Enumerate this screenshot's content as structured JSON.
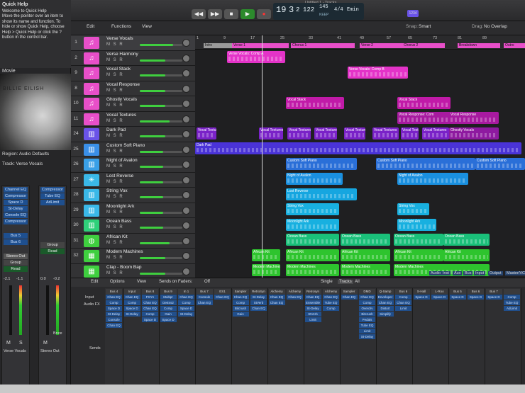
{
  "window": {
    "title": "Untitled 1 - Tracks",
    "lcd": {
      "bar": "19",
      "beat": "3",
      "div": "2",
      "tick": "122",
      "tempo": "145",
      "tempo_label": "KEEP",
      "sig": "4/4",
      "key": "Emin"
    },
    "badge": "1234"
  },
  "quick_help": {
    "title": "Quick Help",
    "lines": [
      "Welcome to Quick Help",
      "Move the pointer over an item to",
      "show its name and function. To",
      "hide or show Quick Help, choose",
      "Help > Quick Help or click the ?",
      "button in the control bar."
    ]
  },
  "inspector": {
    "movie_label": "Movie",
    "image_text_top": "BILLIE EILISH",
    "region_label": "Region: Audio Defaults",
    "track_label": "Track: Verse Vocals",
    "strip_left": {
      "plugins": [
        "Channel EQ",
        "Compressor",
        "Space D",
        "St-Delay",
        "Console EQ",
        "Compressor"
      ],
      "sends": [
        "Bus 5",
        "Bus 6"
      ],
      "output": "Stereo Out",
      "group": "Group",
      "automation": "Read",
      "vals": [
        "-2.1",
        "-1.1"
      ],
      "name": "Verse Vocals"
    },
    "strip_right": {
      "plugins": [
        "Compressor",
        "Tube EQ",
        "AdLimit"
      ],
      "output": "Stereo Out",
      "group": "Group",
      "automation": "Read",
      "vals": [
        "0.0",
        "-0.2"
      ],
      "bounce": "Bnce",
      "name": "Stereo Out"
    }
  },
  "toolbar": {
    "edit": "Edit",
    "functions": "Functions",
    "view": "View",
    "snap_label": "Snap:",
    "snap": "Smart",
    "drag_label": "Drag:",
    "drag": "No Overlap"
  },
  "tracks": [
    {
      "num": "1",
      "name": "Verse Vocals",
      "color": "#e84fc9",
      "icon": "mic-icon",
      "glyph": "♫",
      "vol": 0.78
    },
    {
      "num": "2",
      "name": "Verse Harmony",
      "color": "#e84fc9",
      "icon": "mic-icon",
      "glyph": "♫",
      "vol": 0.6
    },
    {
      "num": "9",
      "name": "Vocal Stack",
      "color": "#e84fc9",
      "icon": "mic-icon",
      "glyph": "♫",
      "vol": 0.6
    },
    {
      "num": "8",
      "name": "Vocal Response",
      "color": "#e84fc9",
      "icon": "mic-icon",
      "glyph": "♫",
      "vol": 0.6
    },
    {
      "num": "10",
      "name": "Ghostly Vocals",
      "color": "#e84fc9",
      "icon": "mic-icon",
      "glyph": "♫",
      "vol": 0.6
    },
    {
      "num": "11",
      "name": "Vocal Textures",
      "color": "#e84fc9",
      "icon": "mic-icon",
      "glyph": "♫",
      "vol": 0.7
    },
    {
      "num": "24",
      "name": "Dark Pad",
      "color": "#6a53e8",
      "icon": "keyboard-icon",
      "glyph": "▥",
      "vol": 0.6
    },
    {
      "num": "25",
      "name": "Custom Soft Piano",
      "color": "#3a8fe8",
      "icon": "piano-icon",
      "glyph": "▥",
      "vol": 0.55
    },
    {
      "num": "26",
      "name": "Night of Avalon",
      "color": "#3aa0e8",
      "icon": "synth-icon",
      "glyph": "▥",
      "vol": 0.55
    },
    {
      "num": "27",
      "name": "Lost Reverse",
      "color": "#3ab8e8",
      "icon": "synth-icon",
      "glyph": "✳",
      "vol": 0.55
    },
    {
      "num": "28",
      "name": "String Vox",
      "color": "#3ab8e8",
      "icon": "synth-icon",
      "glyph": "▥",
      "vol": 0.55
    },
    {
      "num": "29",
      "name": "Moonlight Ark",
      "color": "#3ab8e8",
      "icon": "synth-icon",
      "glyph": "▥",
      "vol": 0.55
    },
    {
      "num": "30",
      "name": "Ocean Bass",
      "color": "#2fd07a",
      "icon": "bass-icon",
      "glyph": "▥",
      "vol": 0.55
    },
    {
      "num": "31",
      "name": "African Kit",
      "color": "#3fcf3f",
      "icon": "drum-icon",
      "glyph": "◍",
      "vol": 0.7
    },
    {
      "num": "32",
      "name": "Modern Machines",
      "color": "#3fcf3f",
      "icon": "drum-machine-icon",
      "glyph": "▦",
      "vol": 0.6
    },
    {
      "num": "",
      "name": "Clap - Boom Bap",
      "color": "#3fcf3f",
      "icon": "drum-icon",
      "glyph": "▦",
      "vol": 0.6
    }
  ],
  "ruler": {
    "numbers": [
      "1",
      "9",
      "17",
      "25",
      "33",
      "41",
      "49",
      "57",
      "65",
      "73",
      "81",
      "89"
    ],
    "markers": [
      {
        "label": "Intro",
        "color": "#9a9a9a"
      },
      {
        "label": "Verse 1",
        "color": "#e84fc9"
      },
      {
        "label": "Chorus 1",
        "color": "#e84fc9"
      },
      {
        "label": "Verse 2",
        "color": "#e84fc9"
      },
      {
        "label": "Chorus 2",
        "color": "#e84fc9"
      },
      {
        "label": "Breakdown",
        "color": "#e84fc9"
      },
      {
        "label": "Outro",
        "color": "#e84fc9"
      }
    ]
  },
  "regions": [
    {
      "row": 0,
      "label": "Verse Vocals: Comp A",
      "color": "#e433c8"
    },
    {
      "row": 1,
      "label": "Verse Vocals: Comp B",
      "color": "#e433c8"
    },
    {
      "row": 3,
      "label": "Vocal Stack",
      "color": "#c11aa8"
    },
    {
      "row": 3,
      "label": "Vocal Stack",
      "color": "#c11aa8"
    },
    {
      "row": 4,
      "label": "Vocal Response: Com",
      "color": "#a81aa0"
    },
    {
      "row": 4,
      "label": "Vocal Response",
      "color": "#a81aa0"
    },
    {
      "row": 5,
      "label": "Ghostly Vocals",
      "color": "#8e1aa0"
    },
    {
      "row": 5,
      "label": "Vocal Textures",
      "color": "#7a22c8"
    },
    {
      "row": 5,
      "label": "Vocal Textures",
      "color": "#7a22c8"
    },
    {
      "row": 5,
      "label": "Vocal Textures",
      "color": "#7a22c8"
    },
    {
      "row": 5,
      "label": "Vocal Textures",
      "color": "#7a22c8"
    },
    {
      "row": 5,
      "label": "Vocal Textures",
      "color": "#7a22c8"
    },
    {
      "row": 5,
      "label": "Vocal Textures",
      "color": "#7a22c8"
    },
    {
      "row": 5,
      "label": "Vocal Textures",
      "color": "#7a22c8"
    },
    {
      "row": 5,
      "label": "Vocal Textures",
      "color": "#7a22c8"
    },
    {
      "row": 6,
      "label": "Dark Pad",
      "color": "#4a33d8"
    },
    {
      "row": 6,
      "label": "Dark Pad",
      "color": "#4a33d8"
    },
    {
      "row": 7,
      "label": "Custom Soft Piano",
      "color": "#2a6fd8"
    },
    {
      "row": 7,
      "label": "Custom Soft Piano",
      "color": "#2a6fd8"
    },
    {
      "row": 7,
      "label": "Custom Soft Piano",
      "color": "#2a6fd8"
    },
    {
      "row": 8,
      "label": "Night of Avalon",
      "color": "#1a90e0"
    },
    {
      "row": 8,
      "label": "Night of Avalon",
      "color": "#1a90e0"
    },
    {
      "row": 9,
      "label": "Lost Reverse",
      "color": "#16a6e0"
    },
    {
      "row": 10,
      "label": "String Vox",
      "color": "#18b0e0"
    },
    {
      "row": 10,
      "label": "String Vox",
      "color": "#18b0e0"
    },
    {
      "row": 11,
      "label": "Moonlight Ark",
      "color": "#18b0e0"
    },
    {
      "row": 11,
      "label": "Moonlight Ark",
      "color": "#18b0e0"
    },
    {
      "row": 12,
      "label": "Ocean Bass",
      "color": "#1ac07a"
    },
    {
      "row": 12,
      "label": "Ocean Bass",
      "color": "#1ac07a"
    },
    {
      "row": 12,
      "label": "Ocean Bass",
      "color": "#1ac07a"
    },
    {
      "row": 12,
      "label": "Ocean Bass",
      "color": "#1ac07a"
    },
    {
      "row": 13,
      "label": "African Kit",
      "color": "#2ec42e"
    },
    {
      "row": 13,
      "label": "African Kit",
      "color": "#2ec42e"
    },
    {
      "row": 13,
      "label": "African Kit",
      "color": "#2ec42e"
    },
    {
      "row": 13,
      "label": "African Kit",
      "color": "#2ec42e"
    },
    {
      "row": 13,
      "label": "African Kit",
      "color": "#2ec42e"
    },
    {
      "row": 14,
      "label": "Modern Machines",
      "color": "#2ec42e"
    },
    {
      "row": 14,
      "label": "Modern Machines",
      "color": "#2ec42e"
    },
    {
      "row": 14,
      "label": "Modern Machines",
      "color": "#2ec42e"
    },
    {
      "row": 14,
      "label": "Modern Machines",
      "color": "#2ec42e"
    },
    {
      "row": 15,
      "label": "Clap - Boom Bap",
      "color": "#2ec42e"
    },
    {
      "row": 15,
      "label": "Clap - Boom Bap",
      "color": "#2ec42e"
    }
  ],
  "mixer": {
    "edit": "Edit",
    "options": "Options",
    "view": "View",
    "sends_on_faders": "Sends on Faders:",
    "off": "Off",
    "tabs": [
      "Single",
      "Tracks",
      "All"
    ],
    "filters": [
      "Audio",
      "Inst",
      "Aux",
      "Bus",
      "Input",
      "Output",
      "Master/VCA"
    ],
    "row_labels": [
      "Input",
      "Audio FX",
      "Sends"
    ],
    "columns": [
      {
        "top": "Bus 4",
        "fx": [
          "Chan EQ",
          "Comp",
          "Space D",
          "St-Delay",
          "Console",
          "Chan EQ"
        ]
      },
      {
        "top": "Input",
        "fx": [
          "Chan EQ",
          "Comp",
          "Space D",
          "St-Delay"
        ]
      },
      {
        "top": "Bus 8",
        "fx": [
          "PSYn",
          "Chan EQ",
          "Chan EQ",
          "Comp",
          "Space D"
        ]
      },
      {
        "top": "Bus 9",
        "fx": [
          "Multipr",
          "DeEss2",
          "Comp",
          "Gain",
          "Space D"
        ]
      },
      {
        "top": "In 1",
        "fx": [
          "Chan EQ",
          "Comp",
          "Space D",
          "St-Delay"
        ]
      },
      {
        "top": "Bus 7",
        "fx": [
          "Console",
          "Chan EQ"
        ]
      },
      {
        "top": "ES1",
        "fx": [
          "Chan EQ"
        ]
      },
      {
        "top": "Sampler",
        "fx": [
          "Chan EQ",
          "Comp",
          "Bitcrush",
          "Gain"
        ]
      },
      {
        "top": "RetroSyn",
        "fx": [
          "St-Delay",
          "StVerb",
          "Chan EQ"
        ]
      },
      {
        "top": "Alchemy",
        "fx": [
          "Chan EQ",
          "Chan EQ"
        ]
      },
      {
        "top": "Alchemy",
        "fx": [
          "Chan EQ"
        ]
      },
      {
        "top": "Retrosyn",
        "fx": [
          "Chan EQ",
          "Ensemble",
          "St-Delay",
          "StVerb",
          "Limit"
        ]
      },
      {
        "top": "Alchemy",
        "fx": [
          "Chan EQ",
          "Tube EQ",
          "Comp"
        ]
      },
      {
        "top": "Sampler",
        "fx": [
          "Chan EQ"
        ]
      },
      {
        "top": "DMD",
        "fx": [
          "Chan EQ",
          "Comp",
          "Overdrv",
          "Bitcrush",
          "Pedals",
          "Tube EQ",
          "Limit",
          "St-Delay"
        ]
      },
      {
        "top": "Q-Samp",
        "fx": [
          "Enveloper",
          "Chan EQ",
          "Distort",
          "Simplify"
        ]
      },
      {
        "top": "Bus 6",
        "fx": [
          "Comp",
          "Chan EQ",
          "Limit"
        ]
      },
      {
        "top": "S-Hall",
        "fx": [
          "Space D"
        ]
      },
      {
        "top": "L-Roo",
        "fx": [
          "Space D"
        ]
      },
      {
        "top": "Bus 5",
        "fx": [
          "Space D"
        ]
      },
      {
        "top": "Bus 6",
        "fx": [
          "Space D"
        ]
      },
      {
        "top": "Bus 7",
        "fx": [
          "Space D"
        ]
      },
      {
        "top": "",
        "fx": [
          "Comp",
          "Tube EQ",
          "AdLimit"
        ]
      }
    ]
  },
  "colors": {
    "accent": "#3fcf3f",
    "record": "#e33",
    "play": "#3fcf3f"
  }
}
